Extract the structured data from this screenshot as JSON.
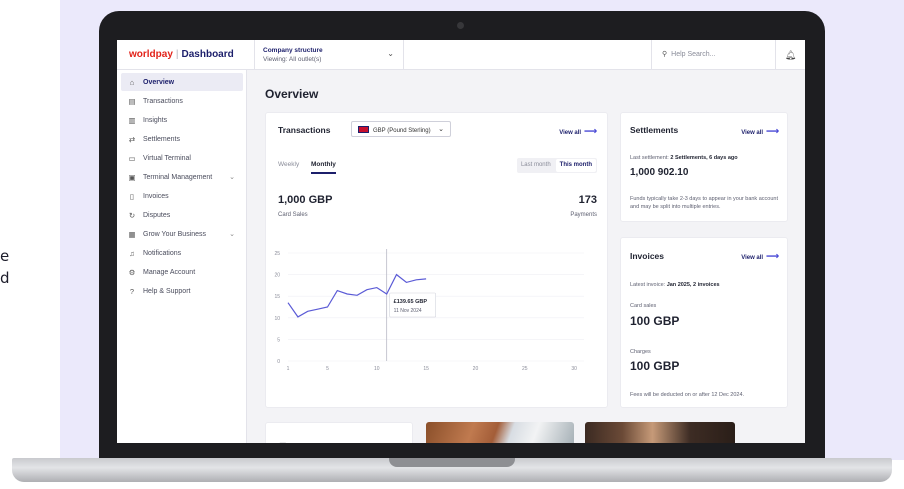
{
  "side_text": [
    "e",
    "d"
  ],
  "topbar": {
    "brand": "worldpay",
    "separator": "|",
    "app": "Dashboard",
    "company_title": "Company structure",
    "company_viewing": "Viewing: All outlet(s)",
    "search_placeholder": "Help Search..."
  },
  "sidebar": {
    "items": [
      {
        "label": "Overview",
        "icon": "home-icon",
        "active": true
      },
      {
        "label": "Transactions",
        "icon": "list-icon"
      },
      {
        "label": "Insights",
        "icon": "chart-icon"
      },
      {
        "label": "Settlements",
        "icon": "arrows-icon"
      },
      {
        "label": "Virtual Terminal",
        "icon": "monitor-icon"
      },
      {
        "label": "Terminal Management",
        "icon": "terminal-icon",
        "expandable": true
      },
      {
        "label": "Invoices",
        "icon": "document-icon"
      },
      {
        "label": "Disputes",
        "icon": "refresh-icon"
      },
      {
        "label": "Grow Your Business",
        "icon": "store-icon",
        "expandable": true
      },
      {
        "label": "Notifications",
        "icon": "bell-icon"
      },
      {
        "label": "Manage Account",
        "icon": "gear-icon"
      },
      {
        "label": "Help & Support",
        "icon": "help-icon"
      }
    ]
  },
  "main": {
    "title": "Overview",
    "transactions": {
      "title": "Transactions",
      "currency": "GBP (Pound Sterling)",
      "view_all": "View all",
      "tab_weekly": "Weekly",
      "tab_monthly": "Monthly",
      "period_last": "Last month",
      "period_this": "This month",
      "sales_value": "1,000 GBP",
      "sales_label": "Card Sales",
      "payments_value": "173",
      "payments_label": "Payments",
      "tooltip_value": "£139.65 GBP",
      "tooltip_date": "11 Nov 2024"
    },
    "settlements": {
      "title": "Settlements",
      "view_all": "View all",
      "last_prefix": "Last settlement: ",
      "last_detail": "2 Settlements, 6 days ago",
      "amount": "1,000 902.10",
      "note": "Funds typically take 2-3 days to appear in your bank account and may be split into multiple entries."
    },
    "invoices": {
      "title": "Invoices",
      "view_all": "View all",
      "latest_prefix": "Latest invoice: ",
      "latest_detail": "Jan 2025, 2 invoices",
      "card_sales_label": "Card sales",
      "card_sales_value": "100 GBP",
      "charges_label": "Charges",
      "charges_value": "100 GBP",
      "note": "Fees will be deducted on or after 12 Dec 2024."
    }
  },
  "chart_data": {
    "type": "line",
    "x": [
      1,
      2,
      3,
      4,
      5,
      6,
      7,
      8,
      9,
      10,
      11,
      12,
      13,
      14,
      15
    ],
    "values": [
      13.5,
      10.2,
      11.5,
      12,
      12.5,
      16.3,
      15.5,
      15.2,
      16.5,
      17,
      15.5,
      20,
      18.2,
      18.8,
      19
    ],
    "xticks": [
      1,
      5,
      10,
      15,
      20,
      25,
      30
    ],
    "yticks": [
      0,
      5,
      10,
      15,
      20,
      25
    ],
    "xlim": [
      1,
      31
    ],
    "ylim": [
      0,
      25
    ],
    "highlight_x": 11,
    "line_color": "#5b5bd6"
  }
}
